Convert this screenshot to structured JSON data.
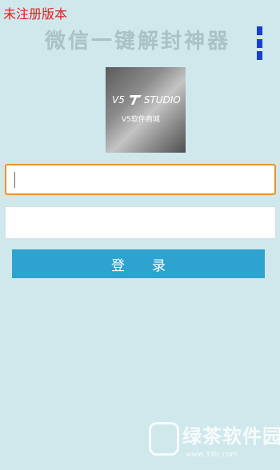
{
  "header": {
    "unregistered_label": "未注册版本",
    "title": "微信一键解封神器"
  },
  "logo": {
    "v5": "V5",
    "studio": "STUDIO",
    "subtitle": "V5软件商城"
  },
  "form": {
    "field1_value": "",
    "field2_value": "",
    "login_label": "登录"
  },
  "watermark": {
    "title": "绿茶软件园",
    "url": "www.33lc.com"
  },
  "colors": {
    "background": "#cfe8ec",
    "accent_button": "#2ea3d0",
    "focus_border": "#e8962a",
    "unregistered_text": "#e02020",
    "menu_icon": "#1a3fd0"
  },
  "icons": [
    "menu-icon",
    "studio-logo-icon",
    "watermark-logo-icon"
  ]
}
